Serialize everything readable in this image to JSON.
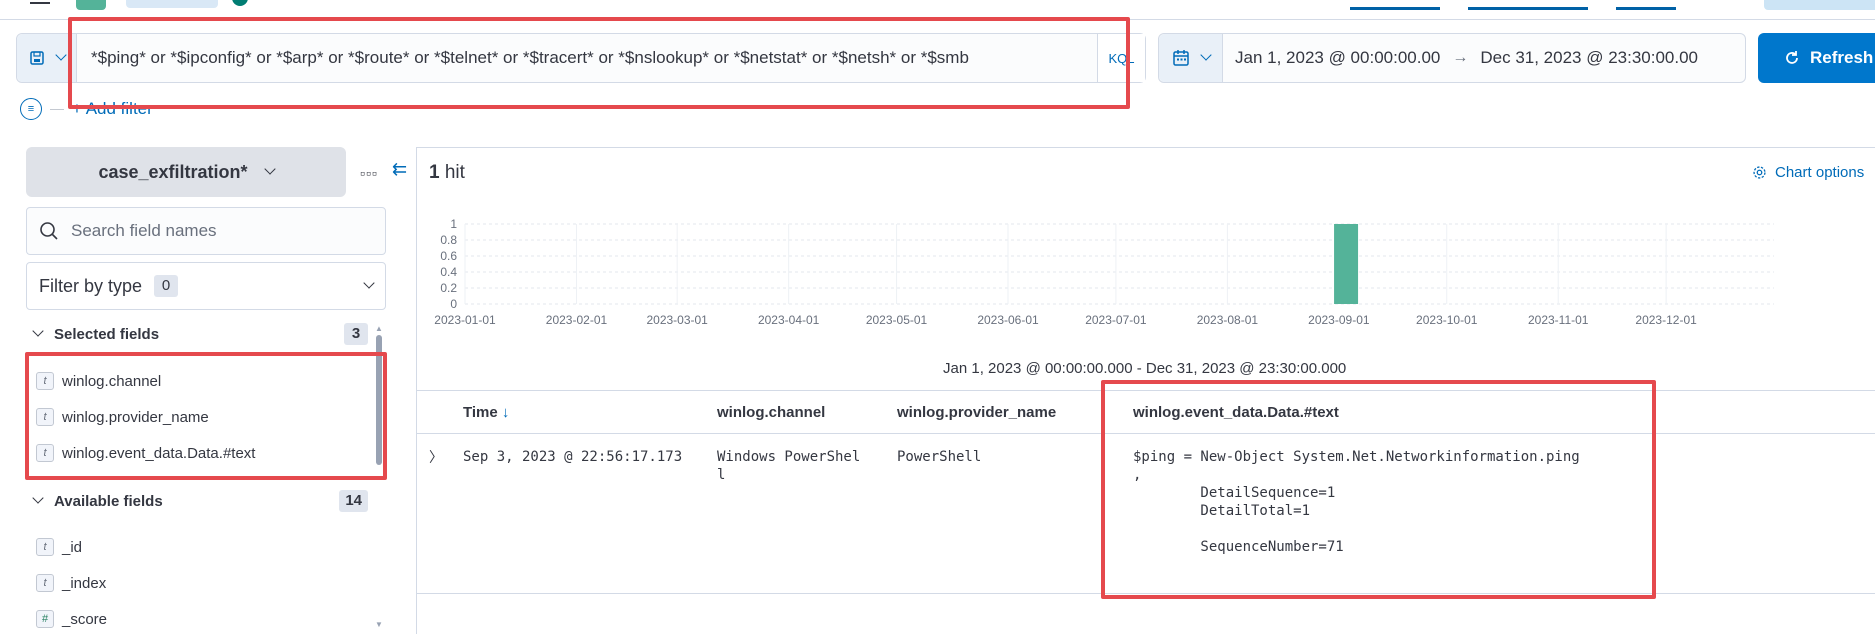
{
  "query": {
    "text": "*$ping* or *$ipconfig* or *$arp* or *$route* or *$telnet* or *$tracert* or *$nslookup* or *$netstat* or *$netsh* or *$smb",
    "language_badge": "KQL"
  },
  "timepicker": {
    "start": "Jan 1, 2023 @ 00:00:00.00",
    "arrow": "→",
    "end": "Dec 31, 2023 @ 23:30:00.00"
  },
  "refresh_label": "Refresh",
  "add_filter_label": "+ Add filter",
  "sidebar": {
    "index_pattern": "case_exfiltration*",
    "search_placeholder": "Search field names",
    "filter_by_type_label": "Filter by type",
    "filter_by_type_count": "0",
    "selected_label": "Selected fields",
    "selected_count": "3",
    "selected_fields": [
      {
        "type": "t",
        "name": "winlog.channel"
      },
      {
        "type": "t",
        "name": "winlog.provider_name"
      },
      {
        "type": "t",
        "name": "winlog.event_data.Data.#text"
      }
    ],
    "available_label": "Available fields",
    "available_count": "14",
    "available_fields": [
      {
        "type": "t",
        "name": "_id"
      },
      {
        "type": "t",
        "name": "_index"
      },
      {
        "type": "#",
        "name": "_score"
      }
    ]
  },
  "results": {
    "hit_count": "1",
    "hit_label": "hit",
    "chart_options_label": "Chart options",
    "date_range": "Jan 1, 2023 @ 00:00:00.000 - Dec 31, 2023 @ 23:30:00.000",
    "columns": [
      "Time",
      "winlog.channel",
      "winlog.provider_name",
      "winlog.event_data.Data.#text"
    ],
    "rows": [
      {
        "time": "Sep 3, 2023 @ 22:56:17.173",
        "channel_line1": "Windows PowerShel",
        "channel_line2": "l",
        "provider": "PowerShell",
        "text_lines": [
          "$ping = New-Object System.Net.Networkinformation.ping",
          ",",
          "        DetailSequence=1",
          "        DetailTotal=1",
          "",
          "        SequenceNumber=71"
        ]
      }
    ]
  },
  "chart_data": {
    "type": "bar",
    "x": [
      "2023-01-01",
      "2023-02-01",
      "2023-03-01",
      "2023-04-01",
      "2023-05-01",
      "2023-06-01",
      "2023-07-01",
      "2023-08-01",
      "2023-09-01",
      "2023-10-01",
      "2023-11-01",
      "2023-12-01"
    ],
    "bars": [
      {
        "x": "2023-09-03",
        "value": 1
      }
    ],
    "y_ticks": [
      "0",
      "0.2",
      "0.4",
      "0.6",
      "0.8",
      "1"
    ],
    "ylim": [
      0,
      1
    ],
    "bar_color": "#54b399",
    "grid": true
  }
}
